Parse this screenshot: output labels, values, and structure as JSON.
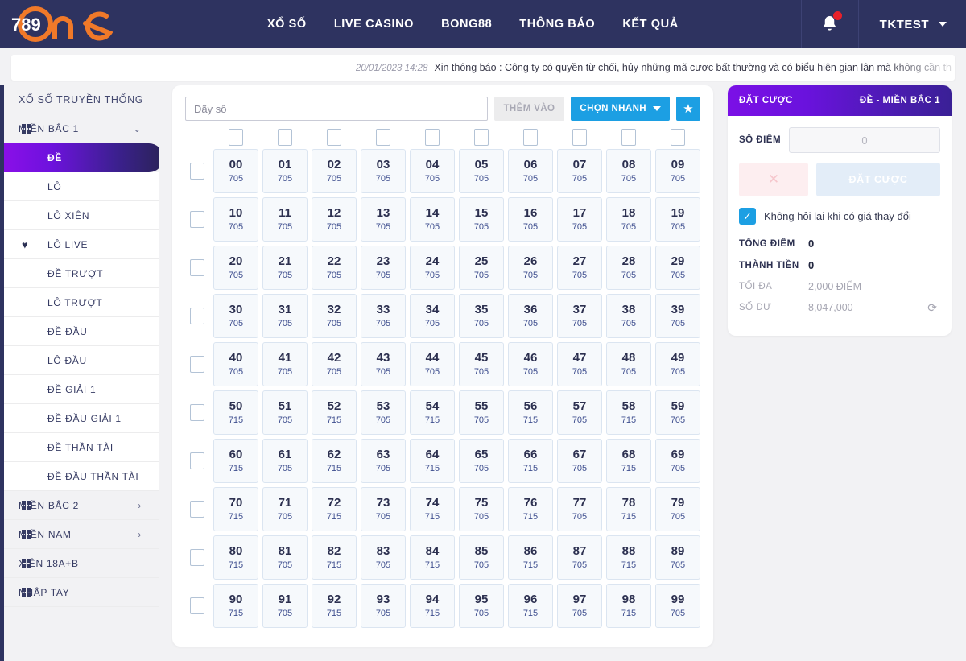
{
  "header": {
    "logo_text": "789",
    "logo_word": "one",
    "nav": [
      {
        "label": "XỔ SỐ"
      },
      {
        "label": "LIVE CASINO"
      },
      {
        "label": "BONG88"
      },
      {
        "label": "THÔNG BÁO"
      },
      {
        "label": "KẾT QUẢ"
      }
    ],
    "bell_icon": "bell-icon",
    "user_name": "TKTEST",
    "caret_icon": "chevron-down-icon",
    "bg_color": "#2e3360",
    "accent_color": "#f07929"
  },
  "notice": {
    "time": "20/01/2023 14:28",
    "text": "Xin thông báo : Công ty có quyền từ chối, hủy những mã cược bất thường và có biểu hiện gian lận mà không cần th"
  },
  "sidebar": {
    "title": "XỔ SỐ TRUYỀN THỐNG",
    "items": [
      {
        "label": "MIỀN BẮC 1",
        "icon": "grid-icon",
        "chevron": "chevron-down-icon",
        "type": "group",
        "expanded": true
      },
      {
        "label": "ĐỀ",
        "type": "sub",
        "active": true
      },
      {
        "label": "LÔ",
        "type": "sub"
      },
      {
        "label": "LÔ XIÊN",
        "type": "sub"
      },
      {
        "label": "LÔ LIVE",
        "type": "sub",
        "icon": "heart-icon"
      },
      {
        "label": "ĐỀ TRƯỢT",
        "type": "sub"
      },
      {
        "label": "LÔ TRƯỢT",
        "type": "sub"
      },
      {
        "label": "ĐỀ ĐẦU",
        "type": "sub"
      },
      {
        "label": "LÔ ĐẦU",
        "type": "sub"
      },
      {
        "label": "ĐỀ GIẢI 1",
        "type": "sub"
      },
      {
        "label": "ĐỀ ĐẦU GIẢI 1",
        "type": "sub"
      },
      {
        "label": "ĐỀ THẦN TÀI",
        "type": "sub"
      },
      {
        "label": "ĐỀ ĐẦU THẦN TÀI",
        "type": "sub"
      },
      {
        "label": "MIỀN BẮC 2",
        "icon": "grid-icon",
        "chevron": "chevron-right-icon",
        "type": "group"
      },
      {
        "label": "MIỀN NAM",
        "icon": "grid-icon",
        "chevron": "chevron-right-icon",
        "type": "group"
      },
      {
        "label": "XIÊN 18A+B",
        "icon": "grid-icon",
        "type": "group"
      },
      {
        "label": "NHẬP TAY",
        "icon": "grid-icon",
        "type": "group"
      }
    ]
  },
  "toolbar": {
    "input_placeholder": "Dãy số",
    "input_value": "",
    "add_label": "THÊM VÀO",
    "quick_label": "CHỌN NHANH",
    "star_icon": "star-icon"
  },
  "grid": {
    "columns": 10,
    "rows": [
      {
        "numbers": [
          "00",
          "01",
          "02",
          "03",
          "04",
          "05",
          "06",
          "07",
          "08",
          "09"
        ],
        "odds": [
          "705",
          "705",
          "705",
          "705",
          "705",
          "705",
          "705",
          "705",
          "705",
          "705"
        ]
      },
      {
        "numbers": [
          "10",
          "11",
          "12",
          "13",
          "14",
          "15",
          "16",
          "17",
          "18",
          "19"
        ],
        "odds": [
          "705",
          "705",
          "705",
          "705",
          "705",
          "705",
          "705",
          "705",
          "705",
          "705"
        ]
      },
      {
        "numbers": [
          "20",
          "21",
          "22",
          "23",
          "24",
          "25",
          "26",
          "27",
          "28",
          "29"
        ],
        "odds": [
          "705",
          "705",
          "705",
          "705",
          "705",
          "705",
          "705",
          "705",
          "705",
          "705"
        ]
      },
      {
        "numbers": [
          "30",
          "31",
          "32",
          "33",
          "34",
          "35",
          "36",
          "37",
          "38",
          "39"
        ],
        "odds": [
          "705",
          "705",
          "705",
          "705",
          "705",
          "705",
          "705",
          "705",
          "705",
          "705"
        ]
      },
      {
        "numbers": [
          "40",
          "41",
          "42",
          "43",
          "44",
          "45",
          "46",
          "47",
          "48",
          "49"
        ],
        "odds": [
          "705",
          "705",
          "705",
          "705",
          "705",
          "705",
          "705",
          "705",
          "705",
          "705"
        ]
      },
      {
        "numbers": [
          "50",
          "51",
          "52",
          "53",
          "54",
          "55",
          "56",
          "57",
          "58",
          "59"
        ],
        "odds": [
          "715",
          "705",
          "715",
          "705",
          "715",
          "705",
          "715",
          "705",
          "715",
          "705"
        ]
      },
      {
        "numbers": [
          "60",
          "61",
          "62",
          "63",
          "64",
          "65",
          "66",
          "67",
          "68",
          "69"
        ],
        "odds": [
          "715",
          "705",
          "715",
          "705",
          "715",
          "705",
          "715",
          "705",
          "715",
          "705"
        ]
      },
      {
        "numbers": [
          "70",
          "71",
          "72",
          "73",
          "74",
          "75",
          "76",
          "77",
          "78",
          "79"
        ],
        "odds": [
          "715",
          "705",
          "715",
          "705",
          "715",
          "705",
          "715",
          "705",
          "715",
          "705"
        ]
      },
      {
        "numbers": [
          "80",
          "81",
          "82",
          "83",
          "84",
          "85",
          "86",
          "87",
          "88",
          "89"
        ],
        "odds": [
          "715",
          "705",
          "715",
          "705",
          "715",
          "705",
          "715",
          "705",
          "715",
          "705"
        ]
      },
      {
        "numbers": [
          "90",
          "91",
          "92",
          "93",
          "94",
          "95",
          "96",
          "97",
          "98",
          "99"
        ],
        "odds": [
          "715",
          "705",
          "715",
          "705",
          "715",
          "705",
          "715",
          "705",
          "715",
          "705"
        ]
      }
    ]
  },
  "bet_panel": {
    "title": "ĐẶT CƯỢC",
    "subtitle": "ĐỀ - MIỀN BẮC 1",
    "points_label": "SỐ ĐIỂM",
    "points_placeholder": "0",
    "points_value": "",
    "clear_icon": "close-icon",
    "submit_label": "ĐẶT CƯỢC",
    "checkbox_checked": true,
    "checkbox_label": "Không hỏi lại khi có giá thay đổi",
    "stats": [
      {
        "key": "TỔNG ĐIỂM",
        "value": "0",
        "muted": false
      },
      {
        "key": "THÀNH TIỀN",
        "value": "0",
        "muted": false
      },
      {
        "key": "TỐI ĐA",
        "value": "2,000 ĐIỂM",
        "muted": true
      },
      {
        "key": "SỐ DƯ",
        "value": "8,047,000",
        "muted": true,
        "refresh_icon": "refresh-icon"
      }
    ]
  }
}
